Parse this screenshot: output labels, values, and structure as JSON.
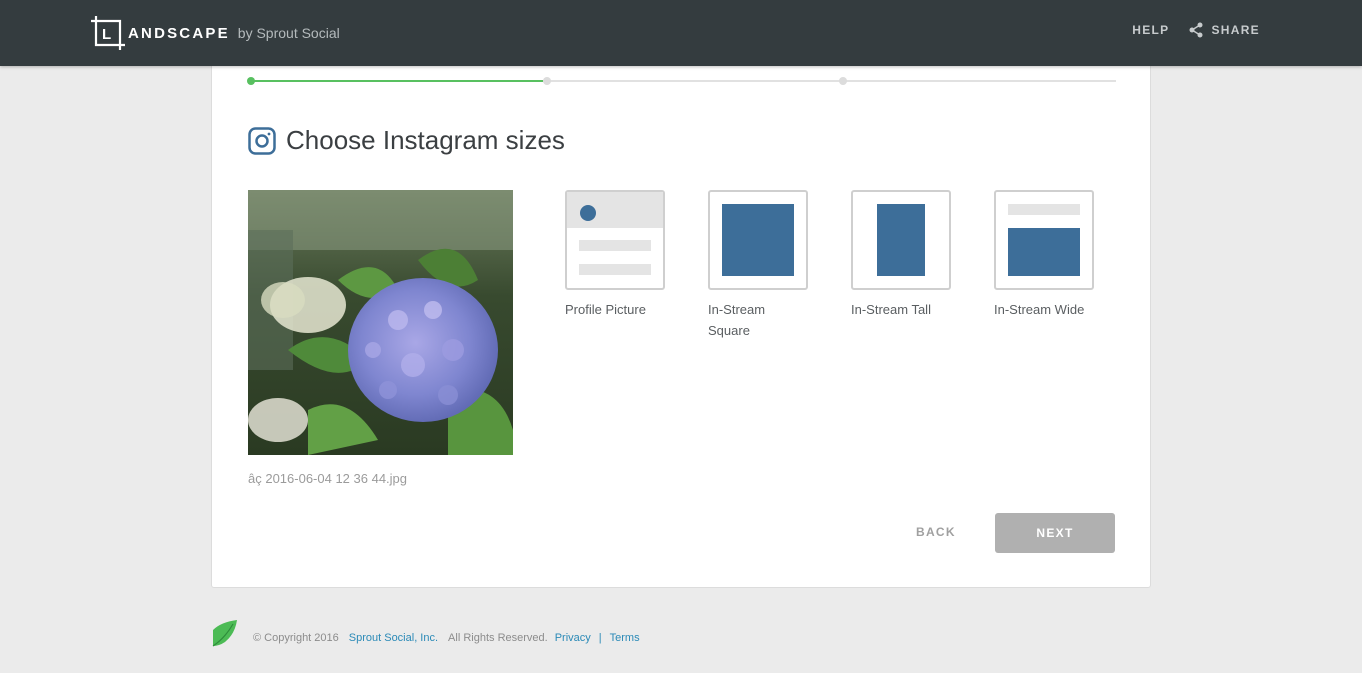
{
  "header": {
    "logo_word": "ANDSCAPE",
    "logo_letter": "L",
    "logo_by": "by Sprout Social",
    "help_label": "HELP",
    "share_label": "SHARE"
  },
  "progress": {
    "value": 0.34,
    "step": 1,
    "total_steps": 3
  },
  "main": {
    "title": "Choose Instagram sizes",
    "title_icon": "instagram-icon",
    "filename": "â 2016-06-04 12 36 44.jpg",
    "filename_display": "âç 2016-06-04 12 36 44.jpg",
    "options": [
      {
        "id": "profile-picture",
        "label": "Profile Picture"
      },
      {
        "id": "in-stream-square",
        "label": "In-Stream Square"
      },
      {
        "id": "in-stream-tall",
        "label": "In-Stream Tall"
      },
      {
        "id": "in-stream-wide",
        "label": "In-Stream Wide"
      }
    ],
    "back_label": "BACK",
    "next_label": "NEXT"
  },
  "footer": {
    "copyright": "© Copyright 2016",
    "company": "Sprout Social, Inc.",
    "rights": "All Rights Reserved.",
    "privacy": "Privacy",
    "separator": "|",
    "terms": "Terms"
  },
  "colors": {
    "header_bg": "#343c3f",
    "accent_green": "#58c060",
    "option_blue": "#3d6e99",
    "link_blue": "#2b8ab7",
    "button_disabled": "#b0b0b0"
  }
}
